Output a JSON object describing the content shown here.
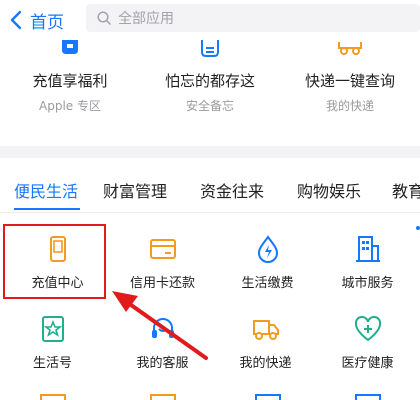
{
  "header": {
    "back_label": "首页",
    "search_placeholder": "全部应用"
  },
  "promos": [
    {
      "title": "充值享福利",
      "subtitle": "Apple 专区",
      "icon": "gift-box-icon"
    },
    {
      "title": "怕忘的都存这",
      "subtitle": "安全备忘",
      "icon": "memo-icon"
    },
    {
      "title": "快递一键查询",
      "subtitle": "我的快递",
      "icon": "delivery-icon"
    }
  ],
  "tabs": [
    {
      "label": "便民生活",
      "active": true
    },
    {
      "label": "财富管理",
      "active": false
    },
    {
      "label": "资金往来",
      "active": false
    },
    {
      "label": "购物娱乐",
      "active": false
    },
    {
      "label": "教育",
      "active": false
    }
  ],
  "services": [
    {
      "label": "充值中心",
      "icon": "phone-icon",
      "highlighted": true
    },
    {
      "label": "信用卡还款",
      "icon": "credit-card-icon"
    },
    {
      "label": "生活缴费",
      "icon": "water-drop-icon"
    },
    {
      "label": "城市服务",
      "icon": "building-icon"
    },
    {
      "label": "生活号",
      "icon": "star-badge-icon"
    },
    {
      "label": "我的客服",
      "icon": "headset-icon"
    },
    {
      "label": "我的快递",
      "icon": "truck-icon"
    },
    {
      "label": "医疗健康",
      "icon": "heart-plus-icon"
    }
  ],
  "colors": {
    "accent": "#1677ff",
    "icon_orange": "#f39a22",
    "icon_blue": "#1677ff",
    "icon_green": "#1fae8e",
    "annotation_red": "#e11b1b"
  }
}
